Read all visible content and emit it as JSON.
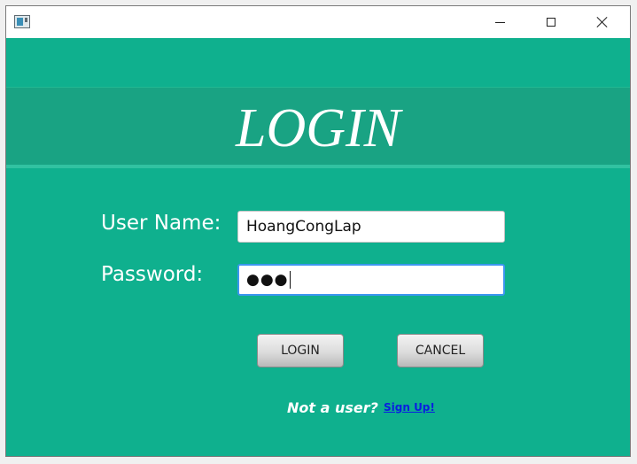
{
  "window": {
    "title": "",
    "icon": "app-window-icon",
    "controls": [
      "minimize-icon",
      "maximize-icon",
      "close-icon"
    ]
  },
  "header": {
    "title": "LOGIN"
  },
  "form": {
    "username_label": "User Name:",
    "username_value": "HoangCongLap",
    "password_label": "Password:",
    "password_masked": "●●●"
  },
  "buttons": {
    "login_label": "LOGIN",
    "cancel_label": "CANCEL"
  },
  "footer": {
    "prompt": "Not a user?",
    "signup_link": "Sign Up!"
  },
  "colors": {
    "background": "#0fb08e",
    "header_band": "#19a383",
    "focus_border": "#3c96f0",
    "link": "#0a1ee0"
  }
}
